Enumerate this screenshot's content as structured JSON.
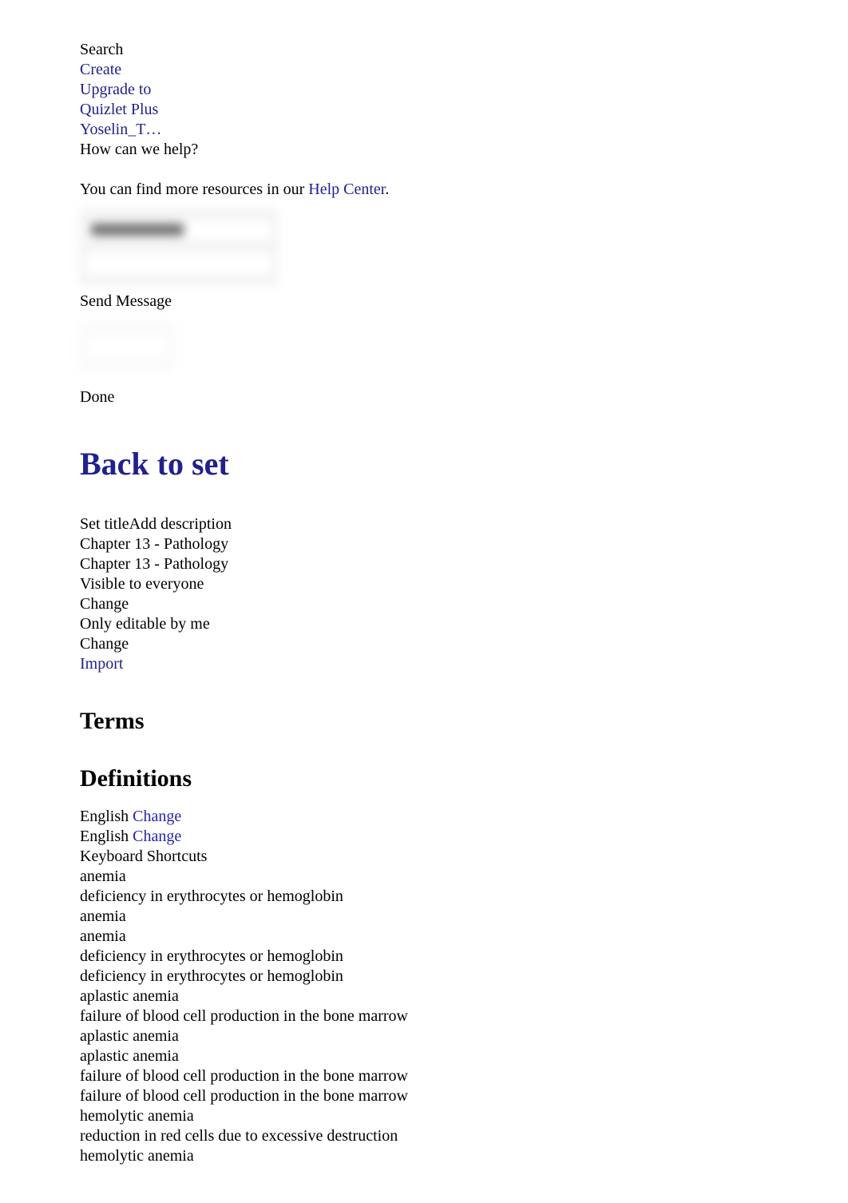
{
  "nav": {
    "search": "Search",
    "create": "Create",
    "upgrade_line1": "Upgrade to",
    "upgrade_line2": "Quizlet Plus",
    "user": "Yoselin_T…"
  },
  "help": {
    "prompt": "How can we help?",
    "resources_prefix": "You can find more resources in our ",
    "help_center_link": "Help Center",
    "resources_suffix": ".",
    "send_message": "Send Message",
    "done": "Done",
    "email_placeholder": "",
    "message_placeholder": ""
  },
  "set": {
    "back_to_set": "Back to set",
    "set_title_label": "Set title",
    "add_description_label": "Add description",
    "title_value": "Chapter 13 - Pathology",
    "description_value": "Chapter 13 - Pathology",
    "visibility": "Visible to everyone",
    "visibility_change": "Change",
    "editability": "Only editable by me",
    "editability_change": "Change",
    "import": "Import"
  },
  "columns": {
    "terms_heading": "Terms",
    "definitions_heading": "Definitions",
    "term_language": "English",
    "term_language_change": "Change",
    "definition_language": "English",
    "definition_language_change": "Change",
    "keyboard_shortcuts": "Keyboard Shortcuts"
  },
  "terms_list": [
    "anemia",
    "deficiency in erythrocytes or hemoglobin",
    "anemia",
    "anemia",
    "deficiency in erythrocytes or hemoglobin",
    "deficiency in erythrocytes or hemoglobin",
    "aplastic anemia",
    "failure of blood cell production in the bone marrow",
    "aplastic anemia",
    "aplastic anemia",
    "failure of blood cell production in the bone marrow",
    "failure of blood cell production in the bone marrow",
    "hemolytic anemia",
    "reduction in red cells due to excessive destruction",
    "hemolytic anemia"
  ],
  "colors": {
    "link": "#21218c",
    "link_bright": "#2525a8",
    "text": "#000000",
    "background": "#ffffff"
  }
}
